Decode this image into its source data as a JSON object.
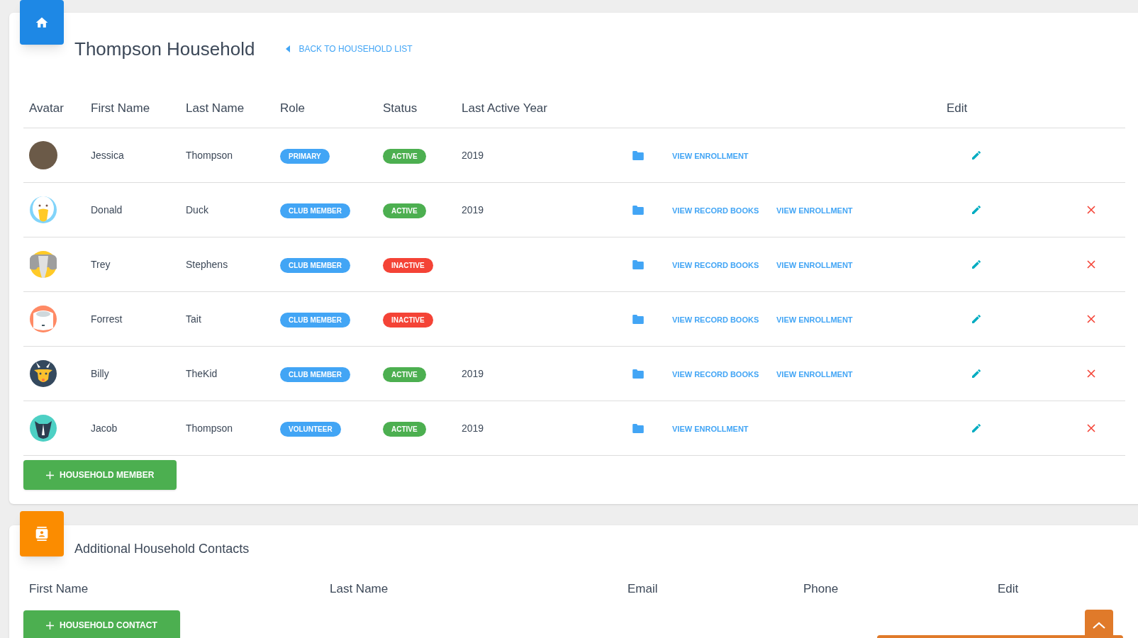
{
  "household": {
    "title": "Thompson Household",
    "back_link": "BACK TO HOUSEHOLD LIST",
    "columns": [
      "Avatar",
      "First Name",
      "Last Name",
      "Role",
      "Status",
      "Last Active Year",
      "Edit"
    ],
    "rows": [
      {
        "kind": "photo",
        "first": "Jessica",
        "last": "Thompson",
        "role": "PRIMARY",
        "status": "ACTIVE",
        "active": true,
        "year": "2019",
        "links": [
          "VIEW ENROLLMENT"
        ],
        "deletable": false
      },
      {
        "kind": "duck",
        "first": "Donald",
        "last": "Duck",
        "role": "CLUB MEMBER",
        "status": "ACTIVE",
        "active": true,
        "year": "2019",
        "links": [
          "VIEW RECORD BOOKS",
          "VIEW ENROLLMENT"
        ],
        "deletable": true
      },
      {
        "kind": "elephant",
        "first": "Trey",
        "last": "Stephens",
        "role": "CLUB MEMBER",
        "status": "INACTIVE",
        "active": false,
        "links": [
          "VIEW RECORD BOOKS",
          "VIEW ENROLLMENT"
        ],
        "deletable": true
      },
      {
        "kind": "sheep",
        "first": "Forrest",
        "last": "Tait",
        "role": "CLUB MEMBER",
        "status": "INACTIVE",
        "active": false,
        "links": [
          "VIEW RECORD BOOKS",
          "VIEW ENROLLMENT"
        ],
        "deletable": true
      },
      {
        "kind": "goat",
        "first": "Billy",
        "last": "TheKid",
        "role": "CLUB MEMBER",
        "status": "ACTIVE",
        "active": true,
        "year": "2019",
        "links": [
          "VIEW RECORD BOOKS",
          "VIEW ENROLLMENT"
        ],
        "deletable": true
      },
      {
        "kind": "rhino",
        "first": "Jacob",
        "last": "Thompson",
        "role": "VOLUNTEER",
        "status": "ACTIVE",
        "active": true,
        "year": "2019",
        "links": [
          "VIEW ENROLLMENT"
        ],
        "deletable": true
      }
    ],
    "add_button": "HOUSEHOLD MEMBER"
  },
  "contacts": {
    "title": "Additional Household Contacts",
    "columns": [
      "First Name",
      "Last Name",
      "Email",
      "Phone",
      "Edit"
    ],
    "add_button": "HOUSEHOLD CONTACT"
  }
}
